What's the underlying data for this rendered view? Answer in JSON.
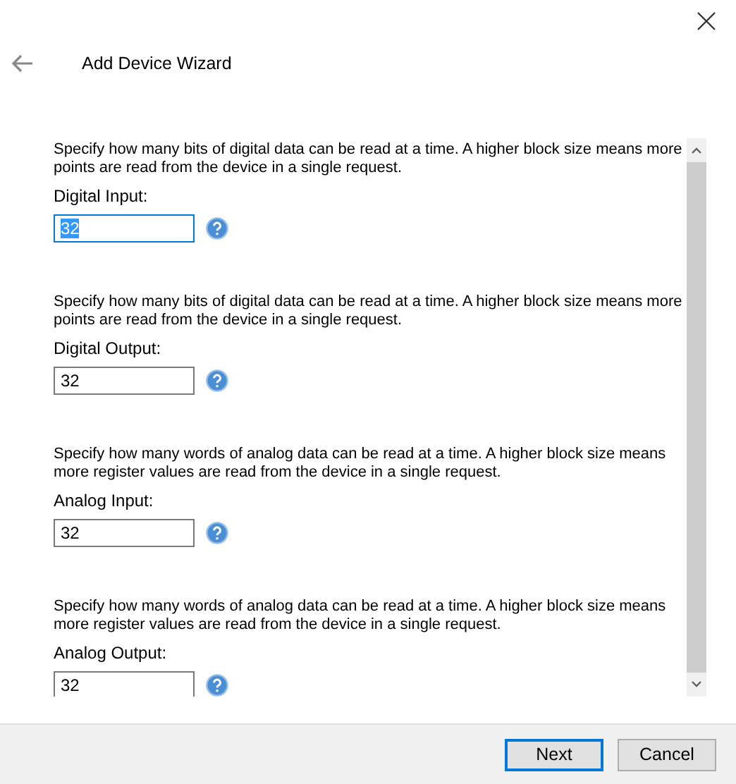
{
  "window": {
    "title": "Add Device Wizard"
  },
  "sections": [
    {
      "description": "Specify how many bits of digital data can be read at a time. A higher block size means more points are read from the device in a single request.",
      "label": "Digital Input:",
      "value": "32",
      "focused": true
    },
    {
      "description": "Specify how many bits of digital data can be read at a time. A higher block size means more points are read from the device in a single request.",
      "label": "Digital Output:",
      "value": "32",
      "focused": false
    },
    {
      "description": "Specify how many words of analog data can be read at a time. A higher block size means more register values are read from the device in a single request.",
      "label": "Analog Input:",
      "value": "32",
      "focused": false
    },
    {
      "description": "Specify how many words of analog data can be read at a time. A higher block size means more register values are read from the device in a single request.",
      "label": "Analog Output:",
      "value": "32",
      "focused": false
    }
  ],
  "buttons": [
    {
      "label": "Next",
      "default": true
    },
    {
      "label": "Cancel",
      "default": false
    }
  ]
}
